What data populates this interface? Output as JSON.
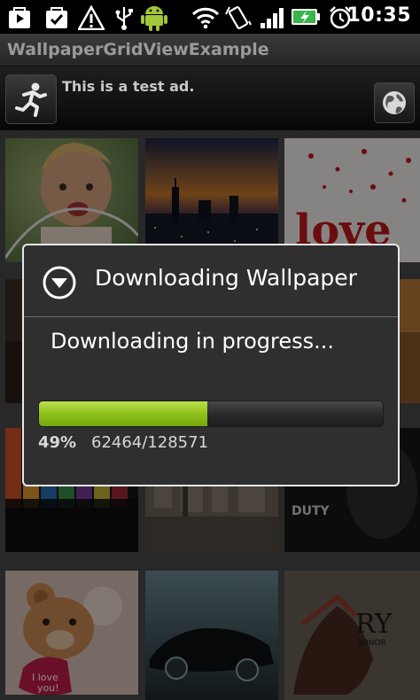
{
  "status_bar": {
    "time": "10:35",
    "icons": [
      "play-store-icon",
      "download-complete-icon",
      "warning-icon",
      "usb-icon",
      "android-icon",
      "wifi-icon",
      "vibrate-icon",
      "signal-icon",
      "battery-charging-icon",
      "alarm-icon"
    ]
  },
  "app": {
    "title": "WallpaperGridViewExample"
  },
  "ad": {
    "text": "This is a test ad."
  },
  "grid": {
    "tiles": [
      "baby-photo",
      "city-sunset",
      "love-hearts",
      "photo-row2-col1",
      "photo-row2-col3",
      "pencils",
      "city-aerial",
      "dark-poster",
      "teddy-bear",
      "sports-car",
      "warrior-poster"
    ]
  },
  "dialog": {
    "title": "Downloading Wallpaper",
    "message": "Downloading in progress...",
    "progress_fraction": 0.49,
    "percent_label": "49%",
    "count_label": "62464/128571"
  },
  "colors": {
    "progress": "#8ec21d",
    "dialog_bg": "#2f2f2f",
    "statusbar": "#000000"
  }
}
